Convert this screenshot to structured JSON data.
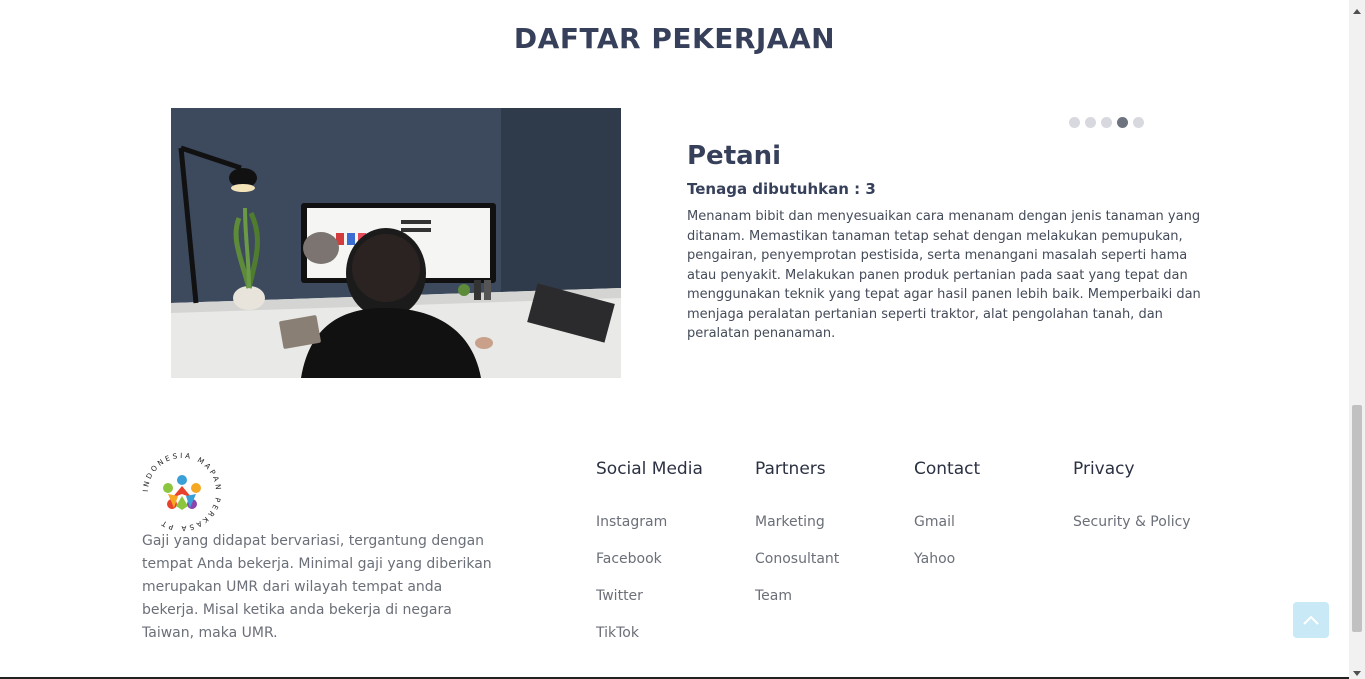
{
  "section": {
    "title": "DAFTAR PEKERJAAN"
  },
  "carousel": {
    "dot_count": 5,
    "active_index": 3
  },
  "job": {
    "title": "Petani",
    "needed": "Tenaga dibutuhkan : 3",
    "description": "Menanam bibit dan menyesuaikan cara menanam dengan jenis tanaman yang ditanam. Memastikan tanaman tetap sehat dengan melakukan pemupukan, pengairan, penyemprotan pestisida, serta menangani masalah seperti hama atau penyakit. Melakukan panen produk pertanian pada saat yang tepat dan menggunakan teknik yang tepat agar hasil panen lebih baik. Memperbaiki dan menjaga peralatan pertanian seperti traktor, alat pengolahan tanah, dan peralatan penanaman."
  },
  "footer": {
    "logo_ring_text": "INDONESIA MAPAN PERKASA PT",
    "about": "Gaji yang didapat bervariasi, tergantung dengan tempat Anda bekerja. Minimal gaji yang diberikan merupakan UMR dari wilayah tempat anda bekerja. Misal ketika anda bekerja di negara Taiwan, maka UMR.",
    "columns": [
      {
        "heading": "Social Media",
        "links": [
          "Instagram",
          "Facebook",
          "Twitter",
          "TikTok"
        ]
      },
      {
        "heading": "Partners",
        "links": [
          "Marketing",
          "Conosultant",
          "Team"
        ]
      },
      {
        "heading": "Contact",
        "links": [
          "Gmail",
          "Yahoo"
        ]
      },
      {
        "heading": "Privacy",
        "links": [
          "Security & Policy"
        ]
      }
    ]
  },
  "icons": {
    "to_top": "chevron-up-icon",
    "scroll_up": "triangle-up-icon",
    "scroll_down": "triangle-down-icon"
  },
  "colors": {
    "heading": "#37405a",
    "to_top_bg": "#c9e9f6",
    "dot_active": "#6e7380",
    "dot_inactive": "#d7d9de"
  }
}
